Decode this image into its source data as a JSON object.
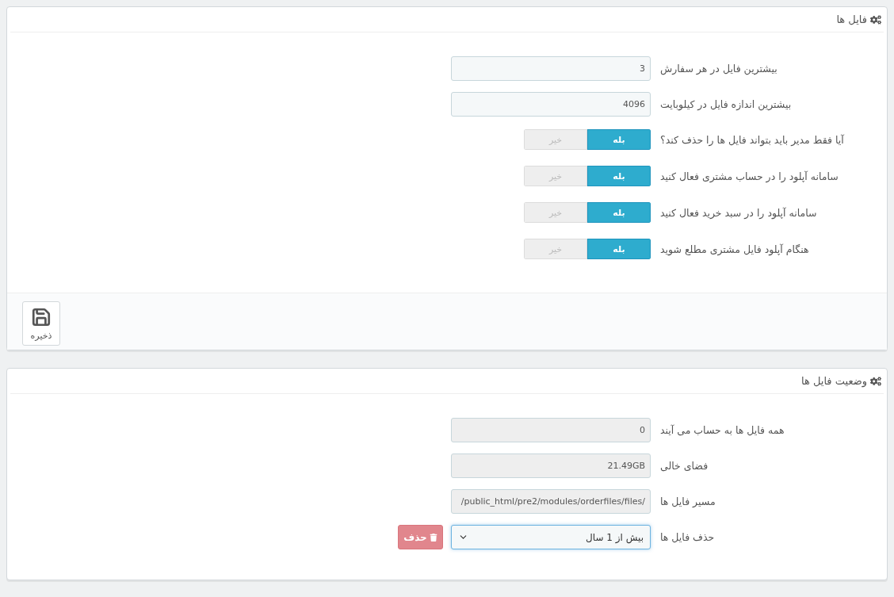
{
  "panels": [
    {
      "title": "فایل ها",
      "rows": [
        {
          "kind": "input",
          "label": "بیشترین فایل در هر سفارش",
          "value": "3"
        },
        {
          "kind": "input",
          "label": "بیشترین اندازه فایل در کیلوبایت",
          "value": "4096"
        },
        {
          "kind": "switch",
          "label": "آیا فقط مدیر باید بتواند فایل ها را حذف کند؟",
          "yes": "بله",
          "no": "خیر",
          "on": true
        },
        {
          "kind": "switch",
          "label": "سامانه آپلود را در حساب مشتری فعال کنید",
          "yes": "بله",
          "no": "خیر",
          "on": true
        },
        {
          "kind": "switch",
          "label": "سامانه آپلود را در سبد خرید فعال کنید",
          "yes": "بله",
          "no": "خیر",
          "on": true
        },
        {
          "kind": "switch",
          "label": "هنگام آپلود فایل مشتری مطلع شوید",
          "yes": "بله",
          "no": "خیر",
          "on": true
        }
      ],
      "footer": {
        "save": "ذخیره"
      }
    },
    {
      "title": "وضعیت فایل ها",
      "rows": [
        {
          "kind": "readonly",
          "label": "همه فایل ها به حساب می آیند",
          "value": "0"
        },
        {
          "kind": "readonly",
          "label": "فضای خالی",
          "value": "21.49GB"
        },
        {
          "kind": "readonly",
          "label": "مسیر فایل ها",
          "value": "/public_html/pre2/modules/orderfiles/files/"
        },
        {
          "kind": "select",
          "label": "حذف فایل ها",
          "value": "بیش از 1 سال",
          "button": "حذف"
        }
      ]
    }
  ]
}
